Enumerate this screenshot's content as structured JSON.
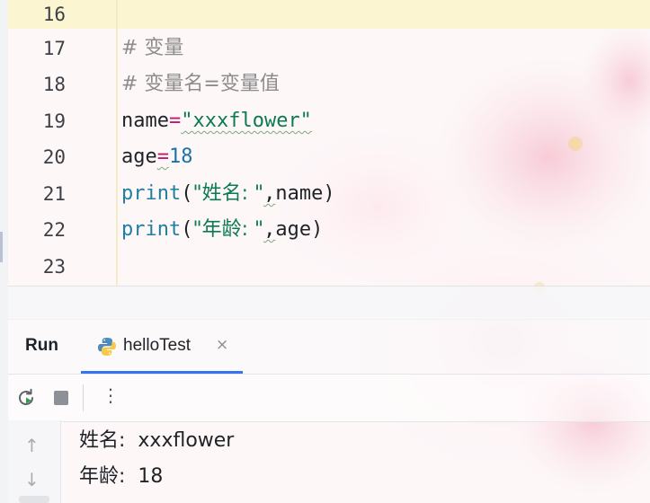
{
  "editor": {
    "line_numbers": [
      "16",
      "17",
      "18",
      "19",
      "20",
      "21",
      "22",
      "23"
    ],
    "lines": {
      "l17_comment": "# 变量",
      "l18_comment": "# 变量名=变量值",
      "l19_name": "name",
      "l19_eq": "=",
      "l19_str": "\"xxxflower\"",
      "l20_name": "age",
      "l20_eq": "=",
      "l20_num": "18",
      "l21_print": "print",
      "l21_open": "(",
      "l21_str": "\"姓名: \"",
      "l21_comma": ",",
      "l21_arg": "name",
      "l21_close": ")",
      "l22_print": "print",
      "l22_open": "(",
      "l22_str": "\"年龄: \"",
      "l22_comma": ",",
      "l22_arg": "age",
      "l22_close": ")"
    }
  },
  "run_panel": {
    "title": "Run",
    "tab": {
      "label": "helloTest",
      "close_glyph": "×"
    },
    "toolbar": {
      "more_glyph": "⋮"
    },
    "gutter": {
      "up_glyph": "↑",
      "down_glyph": "↓"
    },
    "output": [
      "姓名:  xxxflower",
      "年龄:  18"
    ]
  },
  "colors": {
    "accent": "#3574f0",
    "current_line": "#fcf4ce",
    "string": "#0a7a52",
    "number": "#1a73a8",
    "builtin": "#1f7ea1",
    "comment": "#8c8c8c"
  },
  "icons": [
    "python-file-icon",
    "close-icon",
    "rerun-icon",
    "stop-icon",
    "more-options-icon",
    "scroll-up-icon",
    "scroll-down-icon"
  ]
}
